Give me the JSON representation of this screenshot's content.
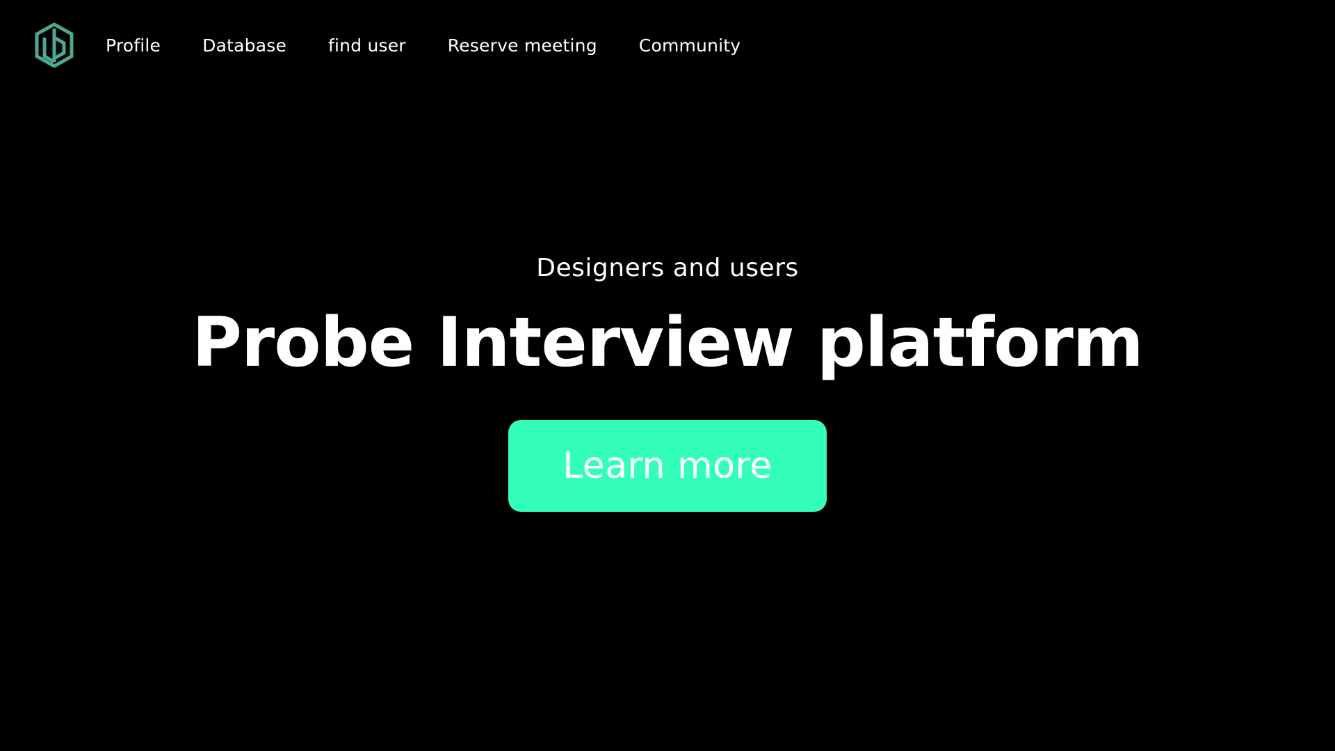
{
  "brand": {
    "logo_icon": "hexagon-logo-icon",
    "logo_color": "#4da892"
  },
  "nav": {
    "items": [
      {
        "label": "Profile"
      },
      {
        "label": "Database"
      },
      {
        "label": "find user"
      },
      {
        "label": "Reserve meeting"
      },
      {
        "label": "Community"
      }
    ]
  },
  "hero": {
    "subtitle": "Designers and users",
    "title": "Probe Interview platform",
    "cta_label": "Learn more",
    "cta_color": "#34ffba"
  },
  "colors": {
    "background": "#000000",
    "text": "#ffffff"
  }
}
